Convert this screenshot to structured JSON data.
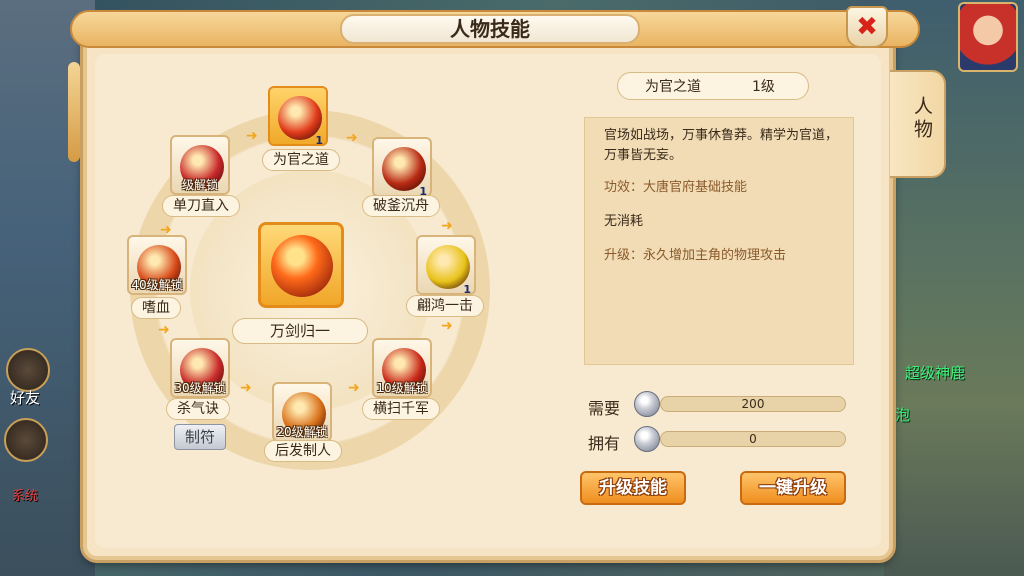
{
  "window": {
    "title": "人物技能",
    "side_tab": "人物"
  },
  "hud": {
    "friends_label": "好友",
    "system_label": "系统",
    "bg_texts": [
      "超级神鹿",
      "泡"
    ]
  },
  "wheel": {
    "center": {
      "name": "万剑归一"
    },
    "skills": [
      {
        "name": "为官之道",
        "level": "1",
        "lock": "",
        "active": true,
        "color": "#e03a1a"
      },
      {
        "name": "破釜沉舟",
        "level": "1",
        "lock": "",
        "active": false,
        "color": "#b82a14"
      },
      {
        "name": "翩鸿一击",
        "level": "1",
        "lock": "",
        "active": false,
        "color": "#e8c21a"
      },
      {
        "name": "横扫千军",
        "level": "",
        "lock": "10级解锁",
        "active": false,
        "color": "#c8281a"
      },
      {
        "name": "后发制人",
        "level": "",
        "lock": "20级解锁",
        "active": false,
        "color": "#d8701a"
      },
      {
        "name": "杀气诀",
        "level": "",
        "lock": "30级解锁",
        "active": false,
        "color": "#c82a2a"
      },
      {
        "name": "嗜血",
        "level": "",
        "lock": "40级解锁",
        "active": false,
        "color": "#d84a1a"
      },
      {
        "name": "单刀直入",
        "level": "",
        "lock": "级解锁",
        "active": false,
        "color": "#c8282a"
      }
    ],
    "craft_label": "制符"
  },
  "detail": {
    "skill_name": "为官之道",
    "skill_level": "1级",
    "description": "官场如战场，万事休鲁莽。精学为官道，万事皆无妄。",
    "effect": "功效：大唐官府基础技能",
    "cost": "无消耗",
    "upgrade": "升级：永久增加主角的物理攻击"
  },
  "resources": {
    "need_label": "需要",
    "need_value": "200",
    "have_label": "拥有",
    "have_value": "0"
  },
  "buttons": {
    "upgrade": "升级技能",
    "one_key": "一键升级"
  }
}
